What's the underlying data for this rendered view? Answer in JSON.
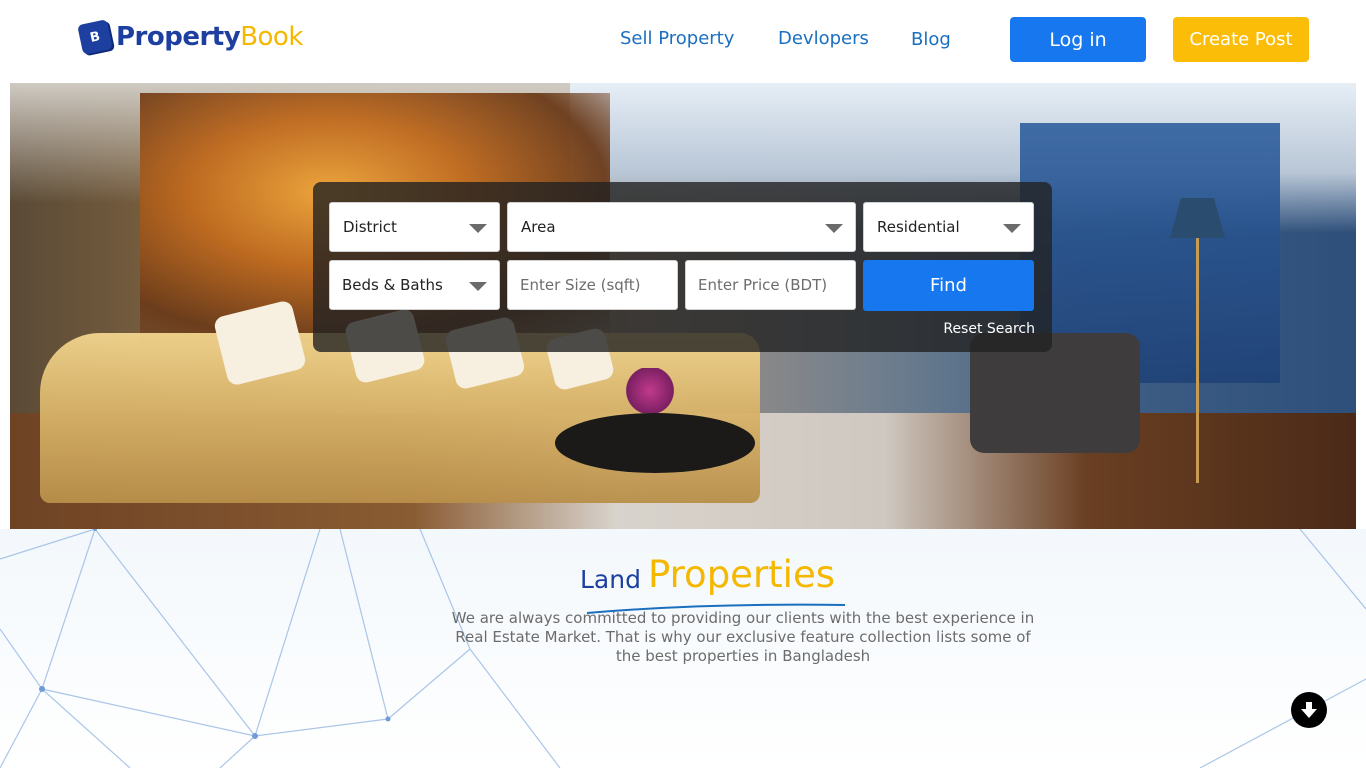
{
  "brand": {
    "part1": "Property",
    "part2": "Book",
    "mark": "B"
  },
  "nav": {
    "items": [
      "Sell Property",
      "Devlopers",
      "Blog"
    ]
  },
  "header": {
    "login_label": "Log in",
    "create_label": "Create Post"
  },
  "search": {
    "district": "District",
    "area": "Area",
    "type": "Residential",
    "beds_baths": "Beds & Baths",
    "size_placeholder": "Enter Size (sqft)",
    "price_placeholder": "Enter Price (BDT)",
    "find_label": "Find",
    "reset_label": "Reset Search"
  },
  "section": {
    "title_small": "Land",
    "title_large": "Properties",
    "description": "We are always committed to providing our clients with the best experience in Real Estate Market. That is why our exclusive feature collection lists some of the best properties in Bangladesh"
  },
  "colors": {
    "primary_blue": "#1677ee",
    "brand_navy": "#1d3fa0",
    "accent_yellow": "#fbbd08",
    "nav_blue": "#1b6fbf"
  },
  "icons": {
    "scroll": "arrow-down-circle-icon",
    "select": "caret-down-icon"
  }
}
